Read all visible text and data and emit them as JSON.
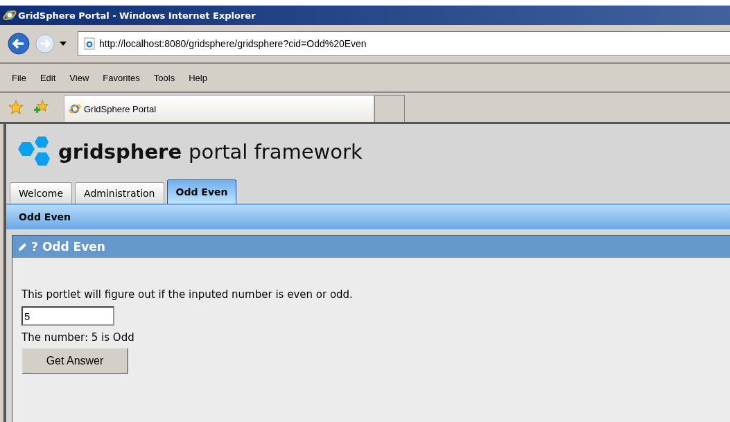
{
  "window": {
    "title": "GridSphere Portal - Windows Internet Explorer"
  },
  "address_bar": {
    "url": "http://localhost:8080/gridsphere/gridsphere?cid=Odd%20Even"
  },
  "menu": [
    "File",
    "Edit",
    "View",
    "Favorites",
    "Tools",
    "Help"
  ],
  "browser_tabs": [
    {
      "label": "GridSphere Portal",
      "selected": true
    }
  ],
  "portal": {
    "brand": "gridsphere",
    "subtitle": "portal framework",
    "tabs": [
      {
        "label": "Welcome",
        "selected": false
      },
      {
        "label": "Administration",
        "selected": false
      },
      {
        "label": "Odd Even",
        "selected": true
      }
    ],
    "subnav": "Odd Even",
    "portlet": {
      "title_mark": "?",
      "title": "Odd Even",
      "description": "This portlet will figure out if the inputed number is even or odd.",
      "input_value": "5",
      "result": "The number: 5 is Odd",
      "button": "Get Answer"
    }
  }
}
